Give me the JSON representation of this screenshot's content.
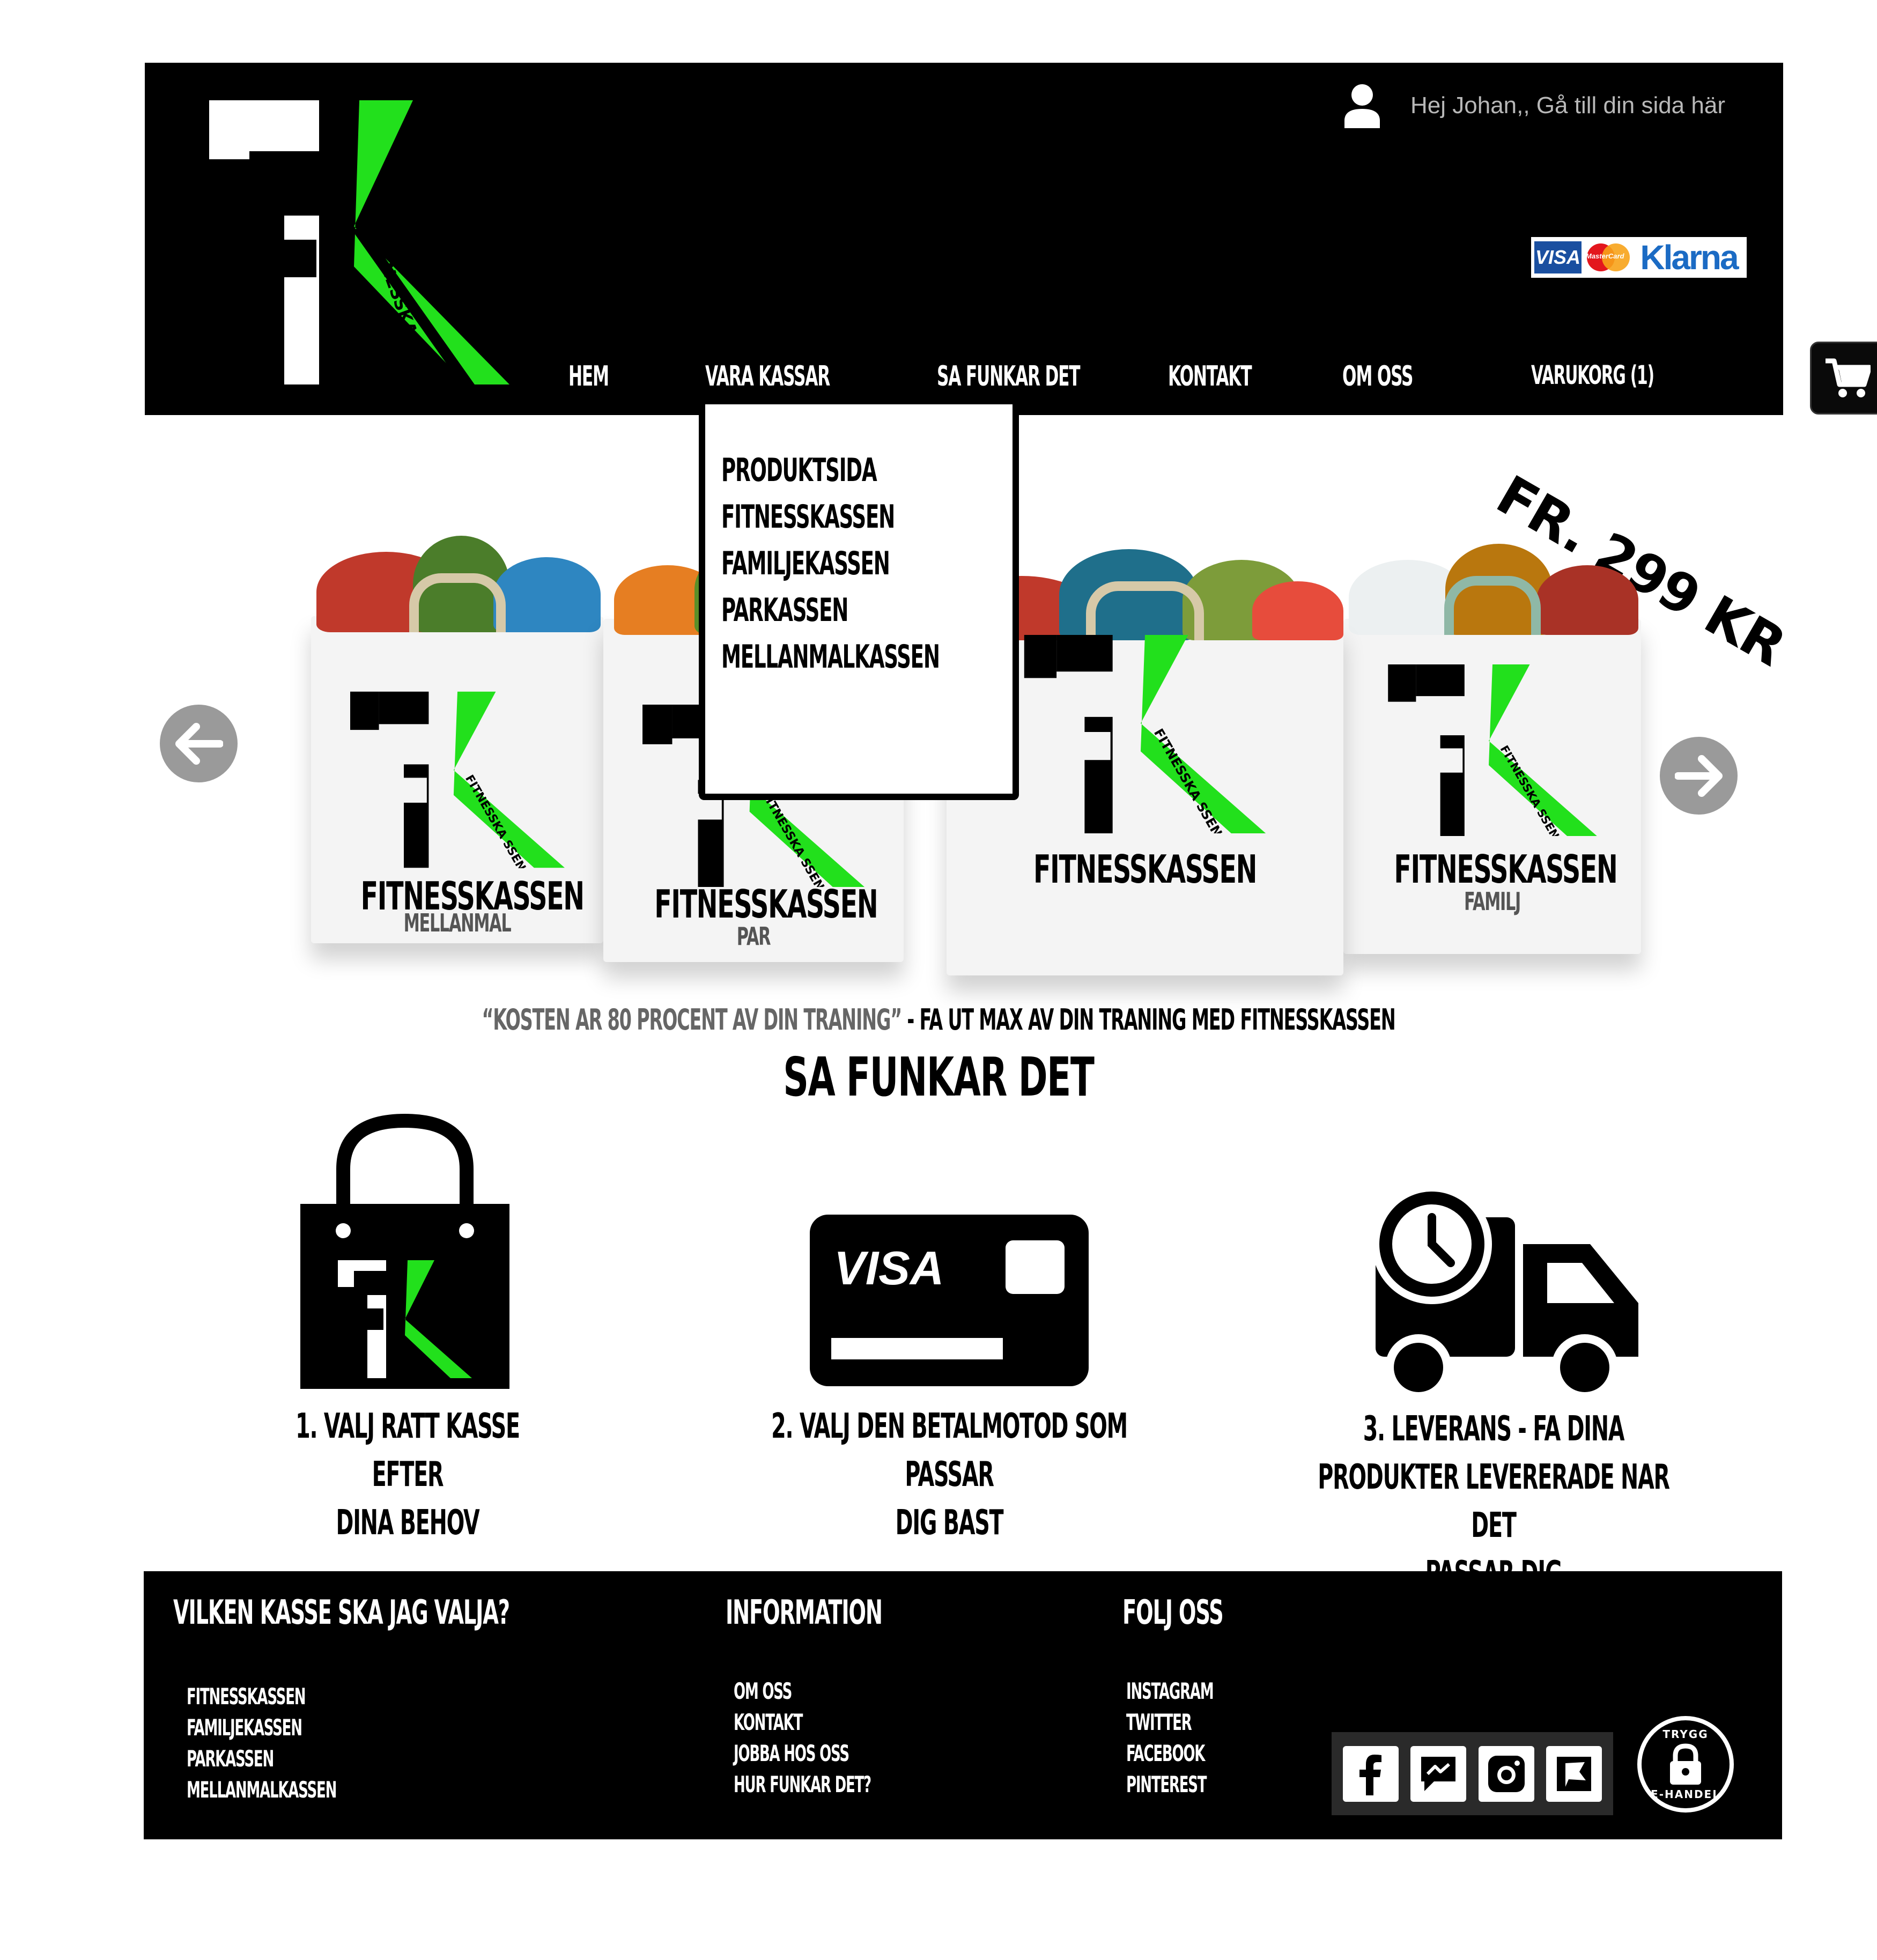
{
  "header": {
    "greeting": "Hej Johan,, Gå till din sida här",
    "cart_label": "VARUKORG (1)",
    "payment": {
      "visa": "VISA",
      "mastercard": "MasterCard",
      "klarna": "Klarna"
    },
    "logo_text": "FITNESSKA SSEN",
    "nav": [
      {
        "label": "HEM"
      },
      {
        "label": "VARA KASSAR"
      },
      {
        "label": "SA FUNKAR DET"
      },
      {
        "label": "KONTAKT"
      },
      {
        "label": "OM OSS"
      }
    ]
  },
  "dropdown": {
    "items": [
      {
        "label": "PRODUKTSIDA"
      },
      {
        "label": "FITNESSKASSEN"
      },
      {
        "label": "FAMILJEKASSEN"
      },
      {
        "label": "PARKASSEN"
      },
      {
        "label": "MELLANMALKASSEN"
      }
    ]
  },
  "hero": {
    "price": "FR. 299 KR",
    "bags": [
      {
        "title": "FITNESSKASSEN",
        "subtitle": "MELLANMAL",
        "logo_text": "FITNESSKA SSEN"
      },
      {
        "title": "FITNESSKASSEN",
        "subtitle": "PAR",
        "logo_text": "FITNESSKA SSEN"
      },
      {
        "title": "FITNESSKASSEN",
        "subtitle": "",
        "logo_text": "FITNESSKA SSEN"
      },
      {
        "title": "FITNESSKASSEN",
        "subtitle": "FAMILJ",
        "logo_text": "FITNESSKA SSEN"
      }
    ]
  },
  "tagline": {
    "quote": "“KOSTEN  AR  80 PROCENT AV DIN TRANING”",
    "rest": " - FA UT MAX AV DIN TRANING MED FITNESSKASSEN"
  },
  "section_title": "SA FUNKAR DET",
  "steps": [
    {
      "line1": "1. VALJ RATT KASSE EFTER",
      "line2": "DINA BEHOV",
      "line3": ""
    },
    {
      "line1": "2. VALJ DEN BETALMOTOD SOM PASSAR",
      "line2": "DIG BAST",
      "line3": "",
      "card_brand": "VISA"
    },
    {
      "line1": "3. LEVERANS - FA DINA",
      "line2": "PRODUKTER  LEVERERADE NAR DET",
      "line3": "PASSAR DIG"
    }
  ],
  "footer": {
    "col1": {
      "heading": "VILKEN KASSE SKA JAG VALJA?",
      "links": [
        "FITNESSKASSEN",
        "FAMILJEKASSEN",
        "PARKASSEN",
        "MELLANMALKASSEN"
      ]
    },
    "col2": {
      "heading": "INFORMATION",
      "links": [
        "OM OSS",
        "KONTAKT",
        "JOBBA HOS OSS",
        "HUR FUNKAR DET?"
      ]
    },
    "col3": {
      "heading": "FOLJ OSS",
      "links": [
        "INSTAGRAM",
        "TWITTER",
        "FACEBOOK",
        "PINTEREST"
      ]
    },
    "social_icons": [
      "facebook-icon",
      "messenger-icon",
      "instagram-icon",
      "flag-icon"
    ],
    "trust_badge": {
      "top": "TRYGG",
      "bottom": "E-HANDEL"
    }
  },
  "colors": {
    "accent": "#22e01c",
    "header_bg": "#000000",
    "arrow_bg": "#9a9a9a",
    "greeting": "#b8b8b8"
  }
}
